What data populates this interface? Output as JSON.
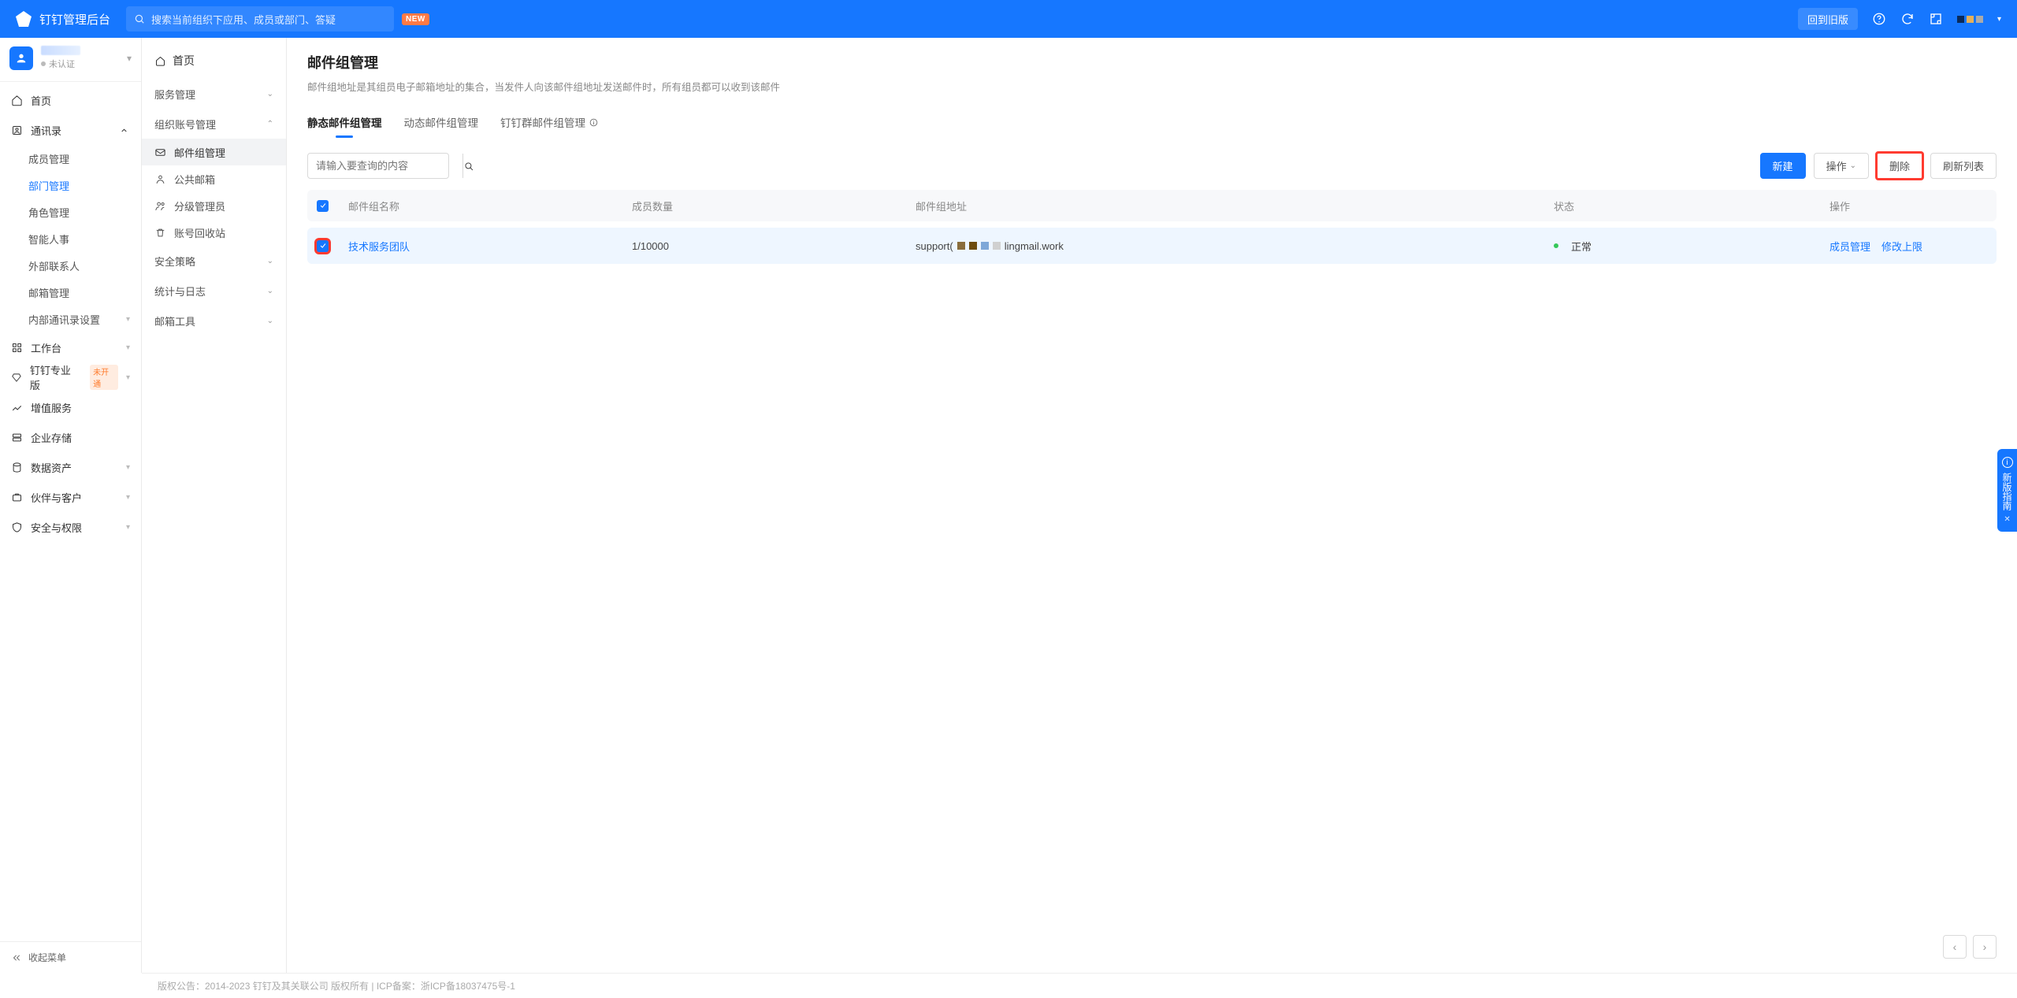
{
  "topbar": {
    "title": "钉钉管理后台",
    "search_placeholder": "搜索当前组织下应用、成员或部门、答疑",
    "new_badge": "NEW",
    "back_old_label": "回到旧版"
  },
  "org": {
    "status_text": "未认证",
    "caret": "▾"
  },
  "leftnav": {
    "home": "首页",
    "contacts": "通讯录",
    "contacts_children": [
      "成员管理",
      "部门管理",
      "角色管理",
      "智能人事",
      "外部联系人",
      "邮箱管理",
      "内部通讯录设置"
    ],
    "workbench": "工作台",
    "pro": "钉钉专业版",
    "pro_tag": "未开通",
    "valueadd": "增值服务",
    "storage": "企业存储",
    "dataasset": "数据资产",
    "partner": "伙伴与客户",
    "security": "安全与权限",
    "collapse": "收起菜单"
  },
  "midnav": {
    "crumb": "首页",
    "service": "服务管理",
    "account": "组织账号管理",
    "account_children": {
      "mailgroup": "邮件组管理",
      "public": "公共邮箱",
      "admin": "分级管理员",
      "recycle": "账号回收站"
    },
    "policy": "安全策略",
    "log": "统计与日志",
    "tool": "邮箱工具"
  },
  "page": {
    "title": "邮件组管理",
    "desc": "邮件组地址是其组员电子邮箱地址的集合，当发件人向该邮件组地址发送邮件时，所有组员都可以收到该邮件"
  },
  "tabs": {
    "a": "静态邮件组管理",
    "b": "动态邮件组管理",
    "c": "钉钉群邮件组管理"
  },
  "toolbar": {
    "search_placeholder": "请输入要查询的内容",
    "create": "新建",
    "ops": "操作",
    "delete": "删除",
    "refresh": "刷新列表"
  },
  "table": {
    "headers": {
      "name": "邮件组名称",
      "count": "成员数量",
      "addr": "邮件组地址",
      "status": "状态",
      "ops": "操作"
    },
    "rows": [
      {
        "name": "技术服务团队",
        "count": "1/10000",
        "addr_prefix": "support(",
        "addr_suffix": "lingmail.work",
        "status": "正常",
        "op_member": "成员管理",
        "op_limit": "修改上限"
      }
    ]
  },
  "footer": "版权公告：2014-2023 钉钉及其关联公司 版权所有 | ICP备案：浙ICP备18037475号-1",
  "guide": "新版指南"
}
